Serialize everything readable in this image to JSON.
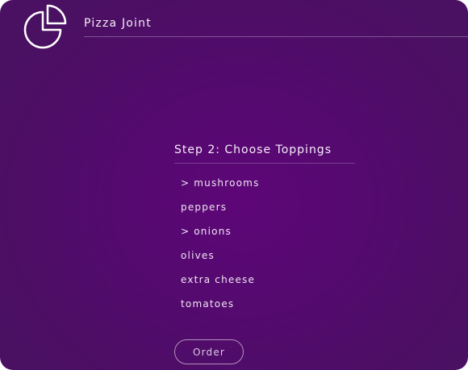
{
  "app": {
    "title": "Pizza Joint",
    "logo_icon": "pizza-pie-chart-icon",
    "accent": "#5e0678"
  },
  "step": {
    "title": "Step 2: Choose Toppings"
  },
  "toppings": [
    {
      "label": "> mushrooms",
      "selected": true
    },
    {
      "label": "peppers",
      "selected": false
    },
    {
      "label": "> onions",
      "selected": true
    },
    {
      "label": "olives",
      "selected": false
    },
    {
      "label": "extra cheese",
      "selected": false
    },
    {
      "label": "tomatoes",
      "selected": false
    }
  ],
  "actions": {
    "order_label": "Order"
  }
}
